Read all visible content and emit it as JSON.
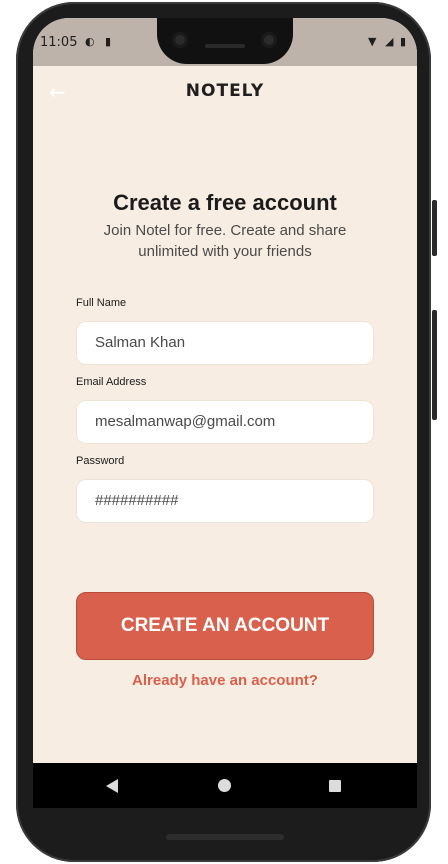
{
  "status_bar": {
    "time": "11:05",
    "left_icons": [
      "contrast-icon",
      "sd-card-icon"
    ],
    "right_icons": [
      "wifi-icon",
      "signal-icon",
      "battery-icon"
    ]
  },
  "header": {
    "back_icon": "arrow-left-icon",
    "app_name": "NOTELY"
  },
  "main": {
    "title": "Create a free account",
    "subtitle": "Join Notel for free. Create and share unlimited with your friends"
  },
  "form": {
    "full_name": {
      "label": "Full Name",
      "value": "Salman Khan"
    },
    "email": {
      "label": "Email Address",
      "value": "mesalmanwap@gmail.com"
    },
    "password": {
      "label": "Password",
      "value": "##########"
    }
  },
  "actions": {
    "create_label": "CREATE AN ACCOUNT",
    "login_link": "Already have an account?"
  },
  "colors": {
    "background": "#f7ede2",
    "accent": "#d9604c",
    "text_dark": "#1b1b1b"
  }
}
